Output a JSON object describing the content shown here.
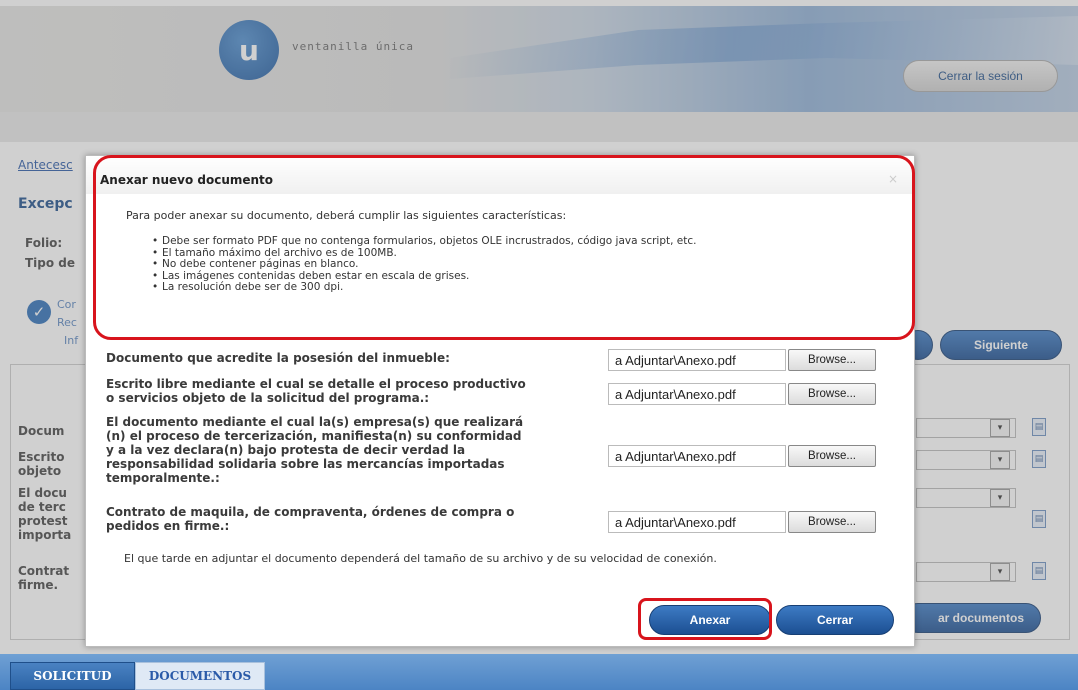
{
  "header": {
    "logo_letter": "u",
    "logo_text": "ventanilla única",
    "logout_label": "Cerrar la sesión"
  },
  "background": {
    "breadcrumb": "Antecesc",
    "title": "Excepc",
    "folio_label": "Folio:",
    "tipo_label": "Tipo de",
    "step_lines": [
      "Cor",
      "Rec",
      "Inf"
    ],
    "doc_labels": [
      [
        "Docum"
      ],
      [
        "Escrito",
        "objeto"
      ],
      [
        "El docu",
        "de terc",
        "protest",
        "importa"
      ],
      [
        "Contrat",
        "firme."
      ]
    ],
    "next_label": "Siguiente",
    "attach_docs_label": "ar documentos",
    "tabs": [
      "SOLICITUD",
      "DOCUMENTOS"
    ]
  },
  "dialog": {
    "title": "Anexar nuevo documento",
    "close_glyph": "×",
    "intro": "Para poder anexar su documento, deberá cumplir las siguientes características:",
    "requirements": [
      "Debe ser formato PDF que no contenga formularios, objetos OLE incrustrados, código java script, etc.",
      "El tamaño máximo del archivo es de 100MB.",
      "No debe contener páginas en blanco.",
      "Las imágenes contenidas deben estar en escala de grises.",
      "La resolución debe ser de 300 dpi."
    ],
    "documents": [
      {
        "label_lines": [
          "Documento que acredite la posesión del inmueble:"
        ],
        "file": "a Adjuntar\\Anexo.pdf",
        "browse": "Browse..."
      },
      {
        "label_lines": [
          "Escrito libre mediante el cual se detalle el proceso productivo",
          "o servicios objeto de la solicitud del programa.:"
        ],
        "file": "a Adjuntar\\Anexo.pdf",
        "browse": "Browse..."
      },
      {
        "label_lines": [
          "El documento mediante el cual la(s) empresa(s) que realizará",
          "(n) el proceso de tercerización, manifiesta(n) su conformidad",
          "y a la vez declara(n) bajo protesta de decir verdad la",
          "responsabilidad solidaria sobre las mercancías importadas",
          "temporalmente.:"
        ],
        "file": "a Adjuntar\\Anexo.pdf",
        "browse": "Browse..."
      },
      {
        "label_lines": [
          "Contrato de maquila, de compraventa, órdenes de compra o",
          "pedidos en firme.:"
        ],
        "file": "a Adjuntar\\Anexo.pdf",
        "browse": "Browse..."
      }
    ],
    "wait_note": "El que tarde en adjuntar el documento dependerá del tamaño de su archivo y de su velocidad de conexión.",
    "attach_label": "Anexar",
    "close_label": "Cerrar"
  },
  "colors": {
    "primary_button": "#1f5aa0",
    "highlight": "#d8141c"
  }
}
